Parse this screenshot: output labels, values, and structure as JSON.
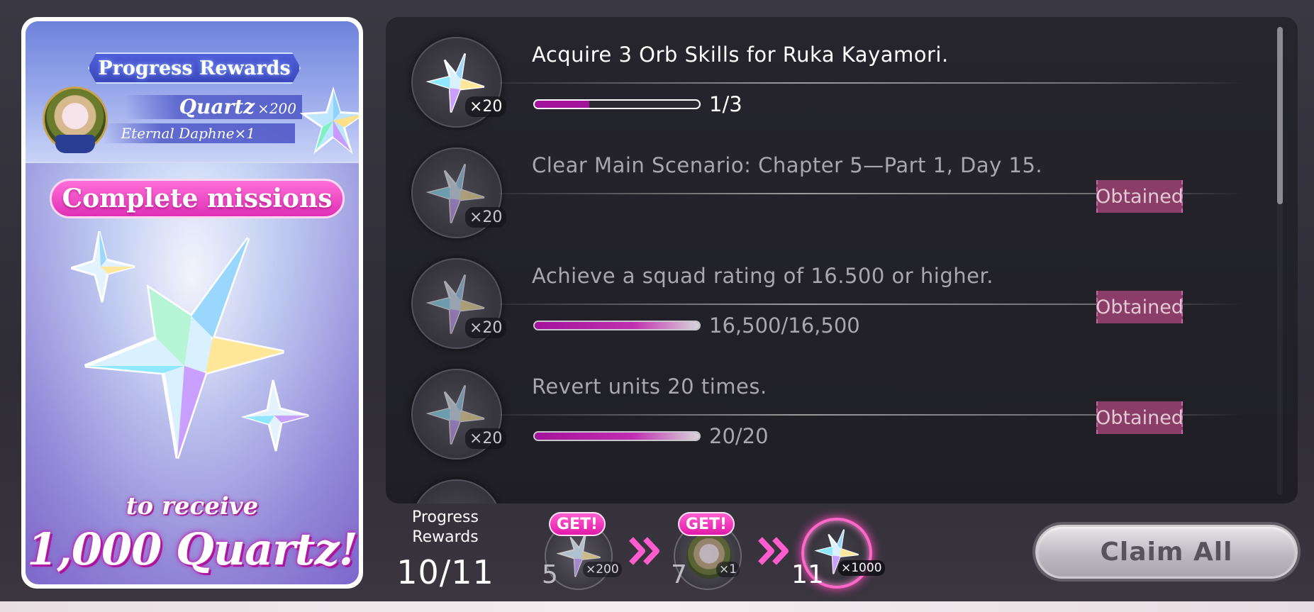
{
  "left_panel": {
    "header_title": "Progress Rewards",
    "quartz_label": "Quartz",
    "quartz_qty": "×200",
    "daphne_label": "Eternal Daphne×1",
    "complete_label": "Complete missions",
    "receive_label": "to receive",
    "promo_label": "1,000 Quartz!"
  },
  "missions": [
    {
      "title": "Acquire 3 Orb Skills for Ruka Kayamori.",
      "reward_qty": "×20",
      "progress": "1/3",
      "progress_fraction": 0.333,
      "status": ""
    },
    {
      "title": "Clear Main Scenario: Chapter 5—Part 1, Day 15.",
      "reward_qty": "×20",
      "progress": "",
      "status": "Obtained"
    },
    {
      "title": "Achieve a squad rating of 16.500 or higher.",
      "reward_qty": "×20",
      "progress": "16,500/16,500",
      "progress_fraction": 1.0,
      "status": "Obtained"
    },
    {
      "title": "Revert units 20 times.",
      "reward_qty": "×20",
      "progress": "20/20",
      "progress_fraction": 1.0,
      "status": "Obtained"
    }
  ],
  "progress_rewards": {
    "label": "Progress\nRewards",
    "count": "10/11",
    "milestones": [
      {
        "number": "5",
        "qty": "×200",
        "badge": "GET!",
        "icon": "quartz-icon"
      },
      {
        "number": "7",
        "qty": "×1",
        "badge": "GET!",
        "icon": "wreath-icon"
      },
      {
        "number": "11",
        "qty": "×1000",
        "badge": "",
        "icon": "quartz-icon"
      }
    ]
  },
  "claim_all_label": "Claim All",
  "colors": {
    "accent_pink": "#e030b5",
    "obtained_badge": "#8a3e67",
    "progress_fill": "#a3129a"
  }
}
